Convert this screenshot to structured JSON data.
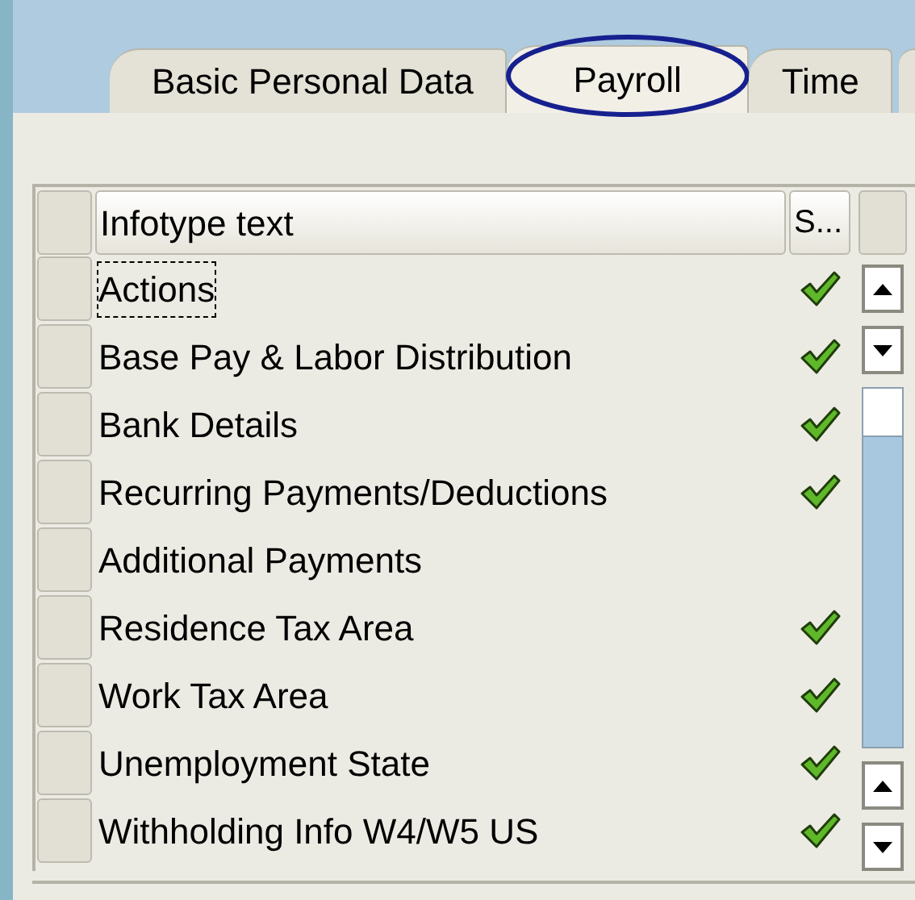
{
  "tabs": [
    {
      "label": "Basic Personal Data",
      "selected": false,
      "highlighted": false
    },
    {
      "label": "Payroll",
      "selected": true,
      "highlighted": true
    },
    {
      "label": "Time",
      "selected": false,
      "highlighted": false
    }
  ],
  "table": {
    "columns": [
      "Infotype text",
      "S..."
    ],
    "rows": [
      {
        "text": "Actions",
        "focused": true,
        "checked": true
      },
      {
        "text": "Base Pay & Labor Distribution",
        "focused": false,
        "checked": true
      },
      {
        "text": "Bank Details",
        "focused": false,
        "checked": true
      },
      {
        "text": "Recurring Payments/Deductions",
        "focused": false,
        "checked": true
      },
      {
        "text": "Additional Payments",
        "focused": false,
        "checked": false
      },
      {
        "text": "Residence Tax Area",
        "focused": false,
        "checked": true
      },
      {
        "text": "Work Tax Area",
        "focused": false,
        "checked": true
      },
      {
        "text": "Unemployment State",
        "focused": false,
        "checked": true
      },
      {
        "text": "Withholding Info W4/W5 US",
        "focused": false,
        "checked": true
      }
    ]
  }
}
